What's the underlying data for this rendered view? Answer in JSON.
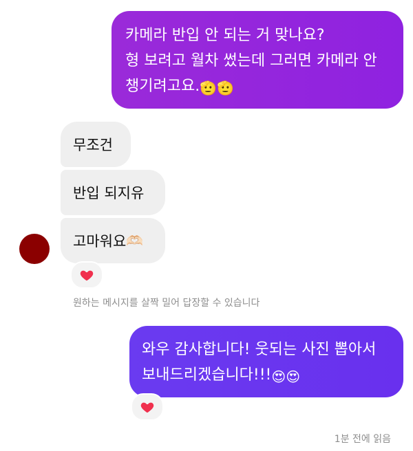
{
  "messages": {
    "outgoing_1": {
      "line1": "카메라 반입 안 되는 거 맞나요?",
      "line2": "형 보려고 월차 썼는데 그러면 카메라 안",
      "line3": "챙기려고요.",
      "emoji": "🫡🫡"
    },
    "incoming": [
      {
        "text": "무조건"
      },
      {
        "text": "반입 되지유"
      },
      {
        "text": "고마워요",
        "emoji": "🫶🏻"
      }
    ],
    "outgoing_2": {
      "line1": "와우 감사합니다! 웃되는 사진 뽑아서",
      "line2": "보내드리겠습니다!!!",
      "emoji": "😍😍"
    }
  },
  "reactions": {
    "incoming_reaction": "heart-icon",
    "outgoing_reaction": "heart-icon"
  },
  "hint": "원하는 메시지를 살짝 밀어 답장할 수 있습니다",
  "read_receipt": "1분 전에 읽음",
  "colors": {
    "outgoing_1_bg": "#9a2ad9",
    "outgoing_2_bg": "#6a3bf0",
    "incoming_bg": "#efefef",
    "avatar": "#8b0000",
    "heart": "#f0304e"
  }
}
